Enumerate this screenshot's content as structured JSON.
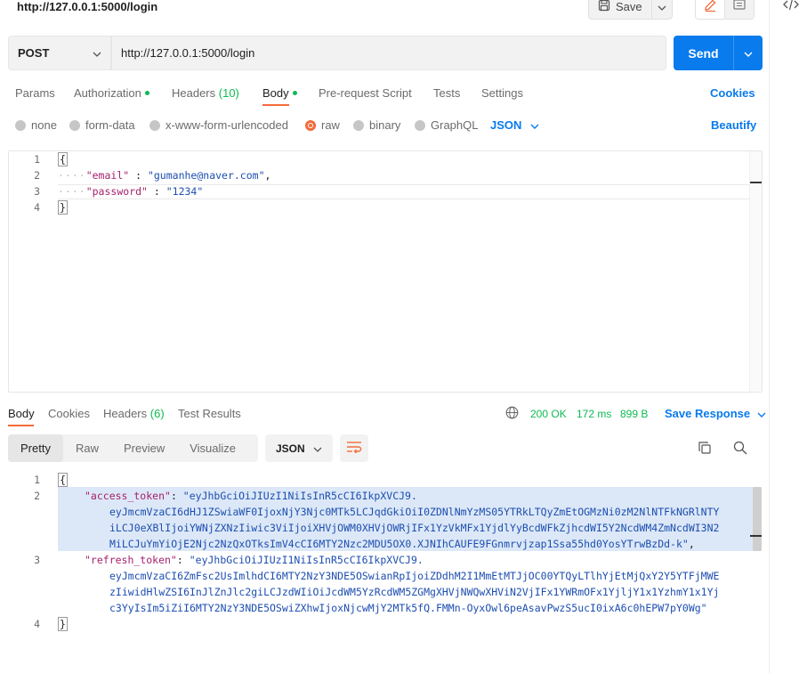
{
  "request": {
    "title": "http://127.0.0.1:5000/login",
    "save_label": "Save",
    "method": "POST",
    "url": "http://127.0.0.1:5000/login",
    "send_label": "Send"
  },
  "request_tabs": {
    "params": "Params",
    "authorization": "Authorization",
    "headers": "Headers",
    "headers_count": "(10)",
    "body": "Body",
    "prerequest": "Pre-request Script",
    "tests": "Tests",
    "settings": "Settings",
    "cookies": "Cookies"
  },
  "body_types": {
    "none": "none",
    "form_data": "form-data",
    "urlencoded": "x-www-form-urlencoded",
    "raw": "raw",
    "binary": "binary",
    "graphql": "GraphQL",
    "format": "JSON",
    "beautify": "Beautify",
    "selected": "raw"
  },
  "request_body": {
    "line_numbers": [
      "1",
      "2",
      "3",
      "4"
    ],
    "open_brace": "{",
    "close_brace": "}",
    "email_key": "\"email\"",
    "email_value": "\"gumanhe@naver.com\"",
    "password_key": "\"password\"",
    "password_value": "\"1234\""
  },
  "response_tabs": {
    "body": "Body",
    "cookies": "Cookies",
    "headers": "Headers",
    "headers_count": "(6)",
    "test_results": "Test Results",
    "status": "200 OK",
    "time": "172 ms",
    "size": "899 B",
    "save_response": "Save Response"
  },
  "response_view": {
    "pretty": "Pretty",
    "raw": "Raw",
    "preview": "Preview",
    "visualize": "Visualize",
    "format": "JSON"
  },
  "response_body": {
    "line_numbers": [
      "1",
      "2",
      "3",
      "4"
    ],
    "open_brace": "{",
    "close_brace": "}",
    "access_key": "\"access_token\"",
    "access_value_1": "\"eyJhbGciOiJIUzI1NiIsInR5cCI6IkpXVCJ9.",
    "access_value_2": "eyJmcmVzaCI6dHJ1ZSwiaWF0IjoxNjY3Njc0MTk5LCJqdGkiOiI0ZDNlNmYzMS05YTRkLTQyZmEtOGMzNi0zM2NlNTFkNGRlNTY",
    "access_value_3": "iLCJ0eXBlIjoiYWNjZXNzIiwic3ViIjoiXHVjOWM0XHVjOWRjIFx1YzVkMFx1YjdlYyBcdWFkZjhcdWI5Y2NcdWM4ZmNcdWI3N2",
    "access_value_4": "MiLCJuYmYiOjE2Njc2NzQxOTksImV4cCI6MTY2Nzc2MDU5OX0.XJNIhCAUFE9FGnmrvjzap1Ssa55hd0YosYTrwBzDd-k\"",
    "refresh_key": "\"refresh_token\"",
    "refresh_value_1": "\"eyJhbGciOiJIUzI1NiIsInR5cCI6IkpXVCJ9.",
    "refresh_value_2": "eyJmcmVzaCI6ZmFsc2UsImlhdCI6MTY2NzY3NDE5OSwianRpIjoiZDdhM2I1MmEtMTJjOC00YTQyLTlhYjEtMjQxY2Y5YTFjMWE",
    "refresh_value_3": "zIiwidHlwZSI6InJlZnJlc2giLCJzdWIiOiJcdWM5YzRcdWM5ZGMgXHVjNWQwXHViN2VjIFx1YWRmOFx1YjljY1x1YzhmY1x1Yj",
    "refresh_value_4": "c3YyIsIm5iZiI6MTY2NzY3NDE5OSwiZXhwIjoxNjcwMjY2MTk5fQ.FMMn-OyxOwl6peAsavPwzS5ucI0ixA6c0hEPW7pY0Wg\""
  },
  "colors": {
    "accent": "#097bed",
    "status_ok": "#0cbb52",
    "active_tab": "#f26b3a",
    "json_key": "#a6216d",
    "json_string": "#1d4eb0"
  }
}
